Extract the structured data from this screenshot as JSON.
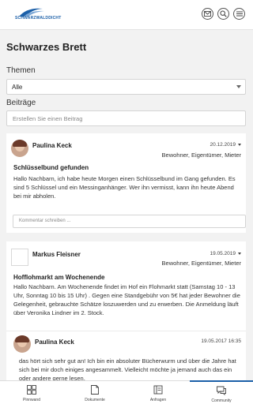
{
  "header": {
    "logo_text": "SCHWARZWALDDICHT",
    "icons": [
      "mail-icon",
      "search-icon",
      "menu-icon"
    ]
  },
  "page": {
    "title": "Schwarzes Brett"
  },
  "filters": {
    "themes_label": "Themen",
    "themes_selected": "Alle",
    "posts_label": "Beiträge",
    "create_placeholder": "Erstellen Sie einen Beitrag"
  },
  "posts": [
    {
      "author": "Paulina Keck",
      "date": "20.12.2019",
      "audience": "Bewohner, Eigentümer, Mieter",
      "title": "Schlüsselbund gefunden",
      "body": "Hallo Nachbarn, ich habe heute Morgen einen Schlüsselbund im Gang gefunden. Es sind 5 Schlüssel und ein Messinganhänger. Wer ihn vermisst, kann ihn heute Abend bei mir abholen.",
      "comment_placeholder": "Kommentar schreiben ..."
    },
    {
      "author": "Markus Fleisner",
      "date": "19.05.2019",
      "audience": "Bewohner, Eigentümer, Mieter",
      "title": "Hofflohmarkt am Wochenende",
      "body": "Hallo Nachbarn. Am Wochenende findet im Hof ein Flohmarkt statt (Samstag 10 - 13 Uhr, Sonntag 10 bis 15 Uhr) . Gegen eine Standgebühr von 5€ hat jeder Bewohner die Gelegenheit, gebrauchte Schätze loszuwerden und zu erwerben. Die Anmeldung läuft über Veronika Lindner im 2. Stock.",
      "reply": {
        "author": "Paulina Keck",
        "date": "19.05.2017 16:35",
        "body": "das hört sich sehr gut an! Ich bin ein absoluter Bücherwurm und über die Jahre hat sich bei mir doch einiges angesammelt. Vielleicht möchte ja jemand auch das ein oder andere gerne lesen."
      }
    }
  ],
  "bottom_nav": [
    {
      "label": "Pinnwand",
      "icon": "grid-icon"
    },
    {
      "label": "Dokumente",
      "icon": "document-icon"
    },
    {
      "label": "Anfragen",
      "icon": "book-icon"
    },
    {
      "label": "Community",
      "icon": "chat-icon"
    }
  ],
  "colors": {
    "accent": "#1b5fa8",
    "background": "#f2f2f2"
  }
}
